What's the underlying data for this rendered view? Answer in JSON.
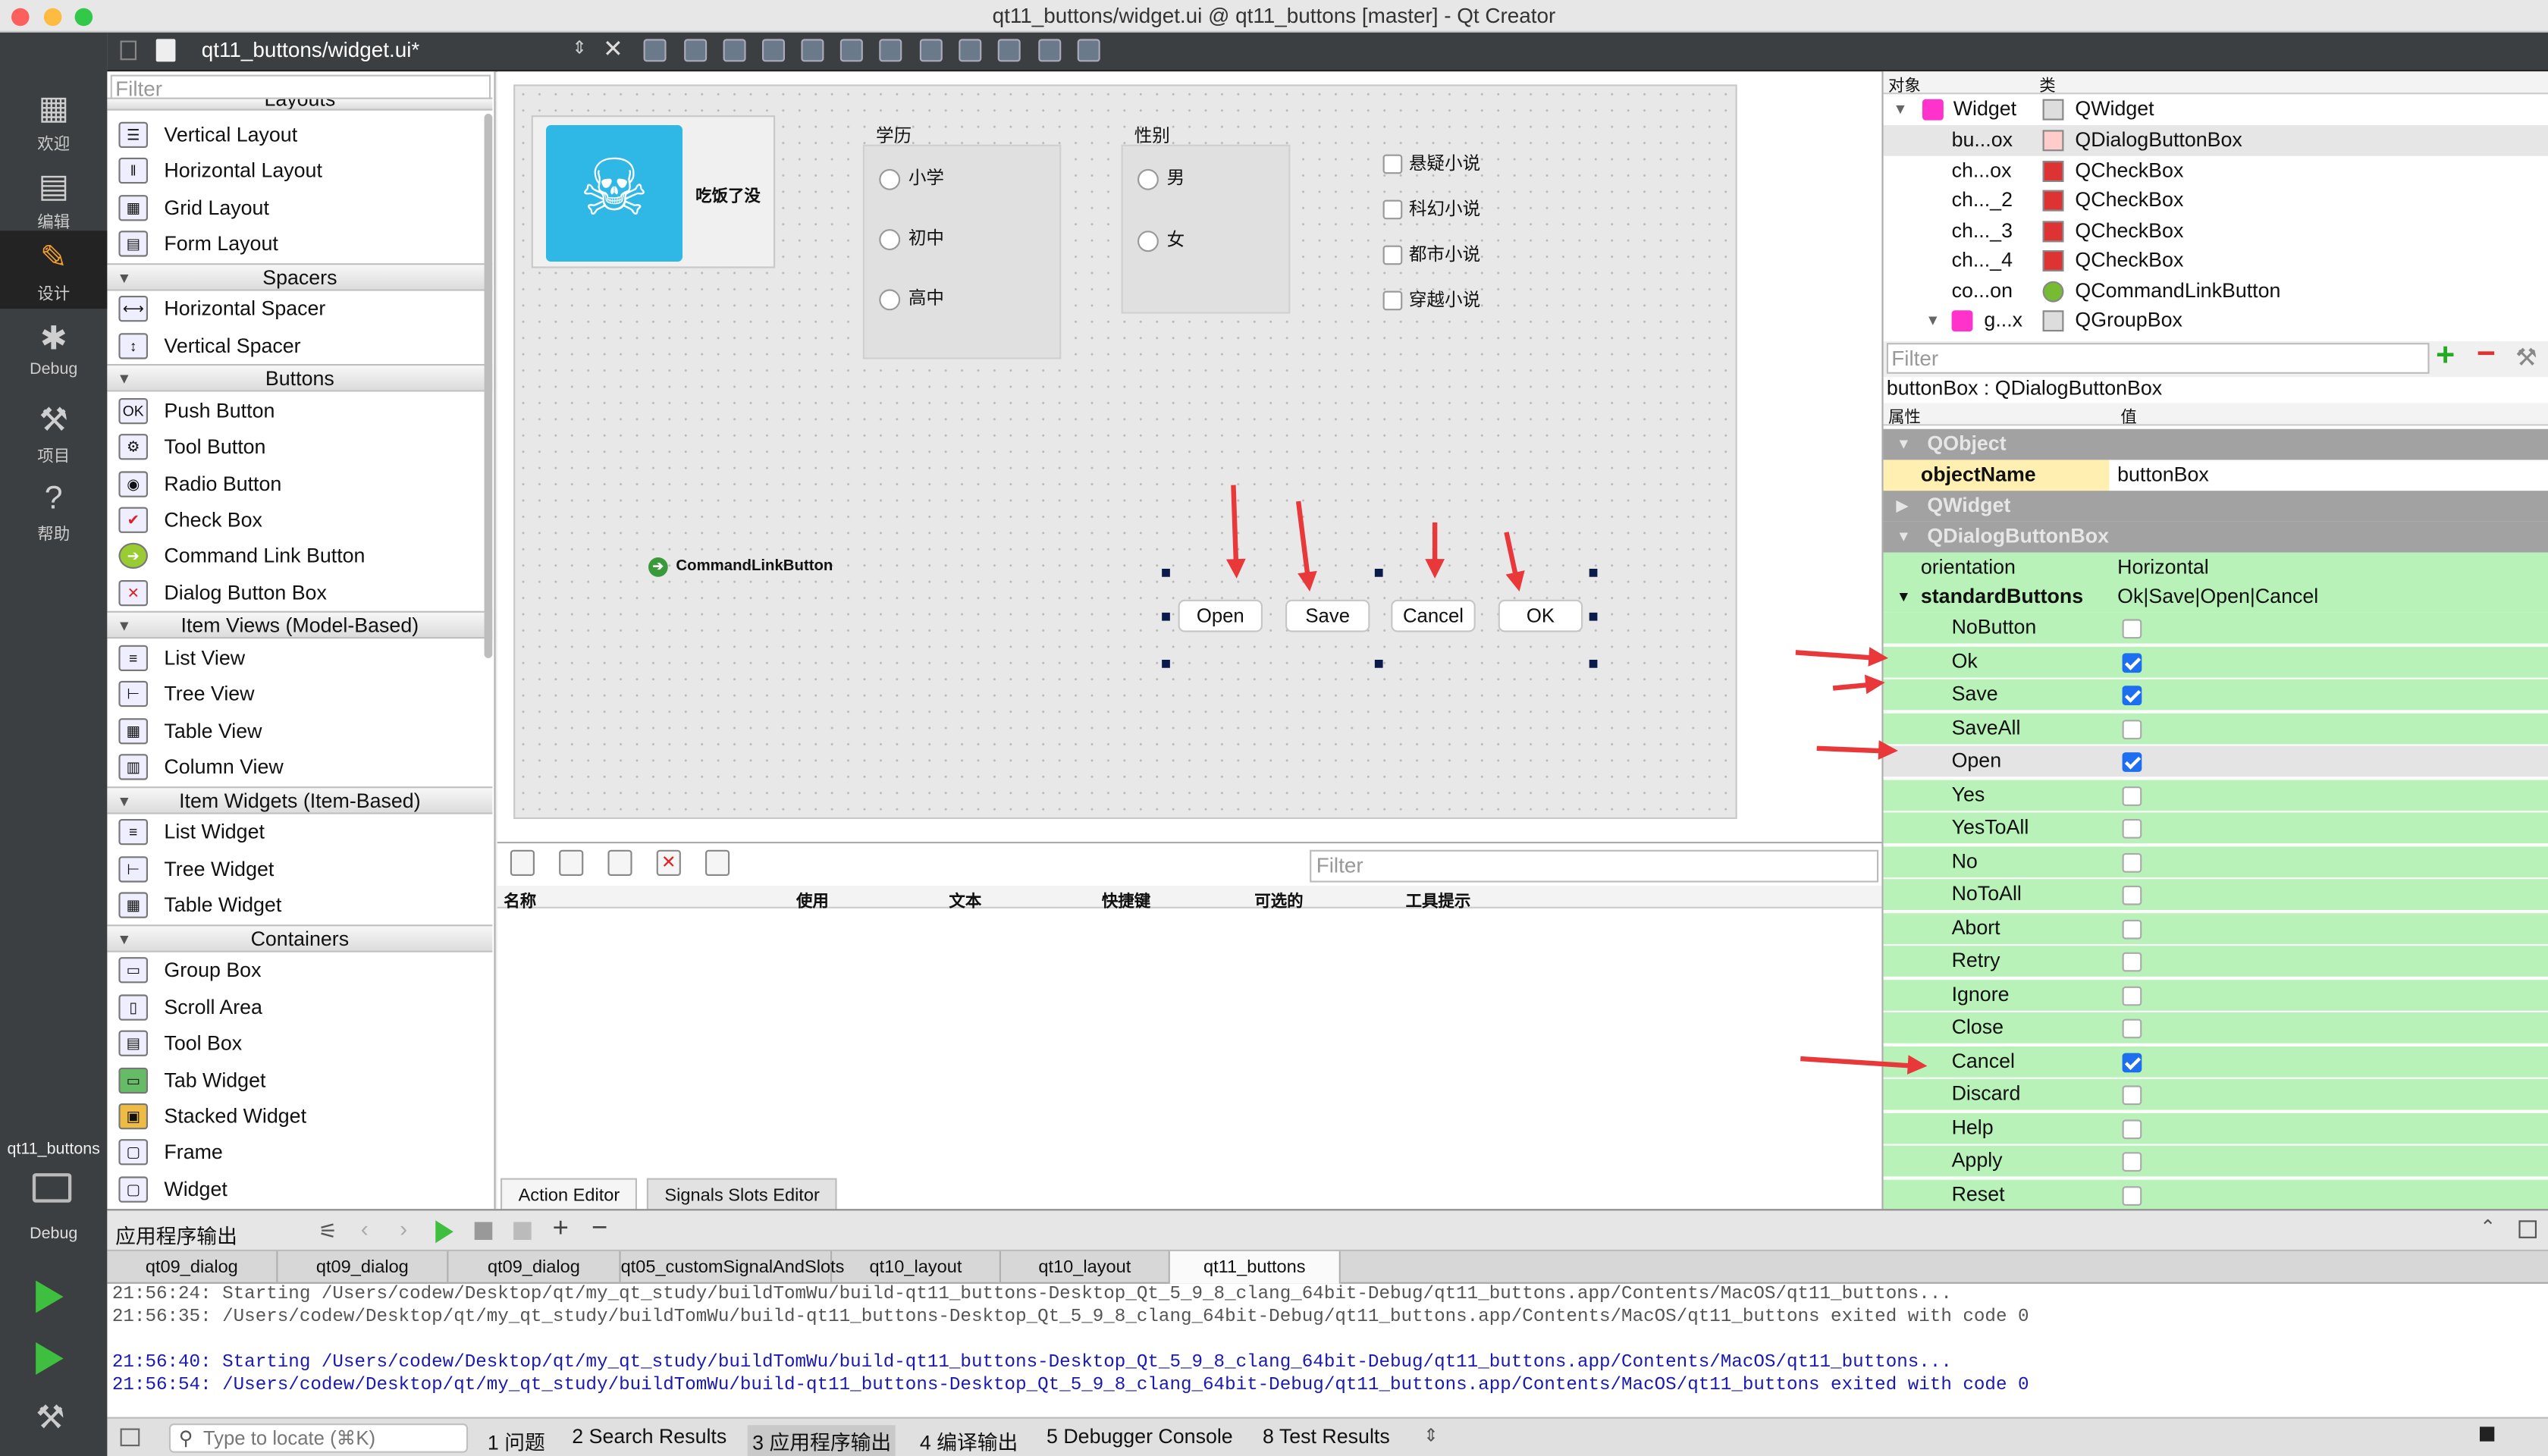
{
  "window": {
    "title": "qt11_buttons/widget.ui @ qt11_buttons [master] - Qt Creator"
  },
  "modes": [
    "欢迎",
    "编辑",
    "设计",
    "Debug",
    "项目",
    "帮助"
  ],
  "kit": {
    "project": "qt11_buttons",
    "config": "Debug"
  },
  "editor_toolbar": {
    "document": "qt11_buttons/widget.ui*"
  },
  "widget_box": {
    "filter_placeholder": "Filter",
    "categories": {
      "layouts": "Layouts",
      "spacers": "Spacers",
      "buttons": "Buttons",
      "item_views": "Item Views (Model-Based)",
      "item_widgets": "Item Widgets (Item-Based)",
      "containers": "Containers"
    },
    "items": [
      "Vertical Layout",
      "Horizontal Layout",
      "Grid Layout",
      "Form Layout",
      "Horizontal Spacer",
      "Vertical Spacer",
      "Push Button",
      "Tool Button",
      "Radio Button",
      "Check Box",
      "Command Link Button",
      "Dialog Button Box",
      "List View",
      "Tree View",
      "Table View",
      "Column View",
      "List Widget",
      "Tree Widget",
      "Table Widget",
      "Group Box",
      "Scroll Area",
      "Tool Box",
      "Tab Widget",
      "Stacked Widget",
      "Frame",
      "Widget"
    ]
  },
  "form": {
    "tool_button_text": "吃饭了没",
    "edu_title": "学历",
    "edu_options": [
      "小学",
      "初中",
      "高中"
    ],
    "gender_title": "性别",
    "gender_options": [
      "男",
      "女"
    ],
    "checkboxes": [
      "悬疑小说",
      "科幻小说",
      "都市小说",
      "穿越小说"
    ],
    "command_link": "CommandLinkButton",
    "dialog_buttons": [
      "Open",
      "Save",
      "Cancel",
      "OK"
    ]
  },
  "action_editor": {
    "filter_placeholder": "Filter",
    "columns": [
      "名称",
      "使用",
      "文本",
      "快捷键",
      "可选的",
      "工具提示"
    ],
    "tabs": [
      "Action Editor",
      "Signals  Slots Editor"
    ]
  },
  "object_inspector": {
    "columns": [
      "对象",
      "类"
    ],
    "rows": [
      {
        "name": "Widget",
        "class": "QWidget"
      },
      {
        "name": "bu...ox",
        "class": "QDialogButtonBox"
      },
      {
        "name": "ch...ox",
        "class": "QCheckBox"
      },
      {
        "name": "ch..._2",
        "class": "QCheckBox"
      },
      {
        "name": "ch..._3",
        "class": "QCheckBox"
      },
      {
        "name": "ch..._4",
        "class": "QCheckBox"
      },
      {
        "name": "co...on",
        "class": "QCommandLinkButton"
      },
      {
        "name": "g...x",
        "class": "QGroupBox"
      }
    ]
  },
  "property_editor": {
    "filter_placeholder": "Filter",
    "title": "buttonBox : QDialogButtonBox",
    "columns": [
      "属性",
      "值"
    ],
    "groups": {
      "qobject": "QObject",
      "qwidget": "QWidget",
      "qdbb": "QDialogButtonBox"
    },
    "object_name": {
      "name": "objectName",
      "value": "buttonBox"
    },
    "orientation": {
      "name": "orientation",
      "value": "Horizontal"
    },
    "standard_buttons": {
      "name": "standardButtons",
      "value": "Ok|Save|Open|Cancel"
    },
    "flags": [
      {
        "name": "NoButton",
        "checked": false
      },
      {
        "name": "Ok",
        "checked": true
      },
      {
        "name": "Save",
        "checked": true
      },
      {
        "name": "SaveAll",
        "checked": false
      },
      {
        "name": "Open",
        "checked": true
      },
      {
        "name": "Yes",
        "checked": false
      },
      {
        "name": "YesToAll",
        "checked": false
      },
      {
        "name": "No",
        "checked": false
      },
      {
        "name": "NoToAll",
        "checked": false
      },
      {
        "name": "Abort",
        "checked": false
      },
      {
        "name": "Retry",
        "checked": false
      },
      {
        "name": "Ignore",
        "checked": false
      },
      {
        "name": "Close",
        "checked": false
      },
      {
        "name": "Cancel",
        "checked": true
      },
      {
        "name": "Discard",
        "checked": false
      },
      {
        "name": "Help",
        "checked": false
      },
      {
        "name": "Apply",
        "checked": false
      },
      {
        "name": "Reset",
        "checked": false
      }
    ]
  },
  "output": {
    "title": "应用程序输出",
    "tabs": [
      "qt09_dialog",
      "qt09_dialog",
      "qt09_dialog",
      "qt05_customSignalAndSlots",
      "qt10_layout",
      "qt10_layout",
      "qt11_buttons"
    ],
    "lines": [
      "21:56:24: Starting /Users/codew/Desktop/qt/my_qt_study/buildTomWu/build-qt11_buttons-Desktop_Qt_5_9_8_clang_64bit-Debug/qt11_buttons.app/Contents/MacOS/qt11_buttons...",
      "21:56:35: /Users/codew/Desktop/qt/my_qt_study/buildTomWu/build-qt11_buttons-Desktop_Qt_5_9_8_clang_64bit-Debug/qt11_buttons.app/Contents/MacOS/qt11_buttons exited with code 0",
      "21:56:40: Starting /Users/codew/Desktop/qt/my_qt_study/buildTomWu/build-qt11_buttons-Desktop_Qt_5_9_8_clang_64bit-Debug/qt11_buttons.app/Contents/MacOS/qt11_buttons...",
      "21:56:54: /Users/codew/Desktop/qt/my_qt_study/buildTomWu/build-qt11_buttons-Desktop_Qt_5_9_8_clang_64bit-Debug/qt11_buttons.app/Contents/MacOS/qt11_buttons exited with code 0"
    ]
  },
  "statusbar": {
    "locator_placeholder": "Type to locate (⌘K)",
    "panes": [
      "1  问题",
      "2  Search Results",
      "3  应用程序输出",
      "4  编译输出",
      "5  Debugger Console",
      "8  Test Results"
    ]
  },
  "colors": {
    "annotation_red": "#e8383a",
    "property_green": "#b9f2b9",
    "property_yellow": "#fff0b2",
    "checkbox_blue": "#1d6ff0"
  }
}
